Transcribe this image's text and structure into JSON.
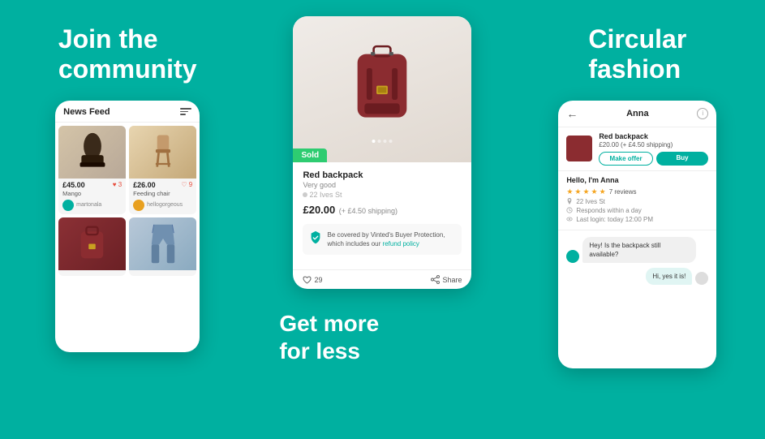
{
  "left": {
    "heading_line1": "Join the",
    "heading_line2": "community",
    "phone": {
      "header": "News Feed",
      "items": [
        {
          "price": "£45.00",
          "likes": "♥ 3",
          "name": "Mango",
          "user": "martonala",
          "type": "boot"
        },
        {
          "price": "£26.00",
          "likes": "♡ 9",
          "name": "Feeding chair",
          "user": "hellogorgeous",
          "type": "chair"
        },
        {
          "price": "",
          "likes": "",
          "name": "",
          "user": "",
          "type": "bag"
        },
        {
          "price": "",
          "likes": "",
          "name": "",
          "user": "",
          "type": "jeans"
        }
      ]
    }
  },
  "center": {
    "product": {
      "sold_badge": "Sold",
      "title": "Red backpack",
      "condition": "Very good",
      "location": "22 Ives St",
      "price": "£20.00",
      "shipping": "(+ £4.50 shipping)",
      "protection_text": "Be covered by Vinted's Buyer Protection, which includes our ",
      "protection_link": "refund policy",
      "likes": "29",
      "share": "Share"
    }
  },
  "bottom": {
    "heading_line1": "Get more",
    "heading_line2": "for less"
  },
  "right": {
    "heading_line1": "Circular",
    "heading_line2": "fashion",
    "phone": {
      "seller_name": "Anna",
      "product_name": "Red backpack",
      "product_price": "£20.00",
      "product_shipping": "(+ £4.50 shipping)",
      "btn_offer": "Make offer",
      "btn_buy": "Buy",
      "greeting": "Hello, I'm Anna",
      "stars": 5,
      "reviews": "7 reviews",
      "location": "22 Ives St",
      "response": "Responds within a day",
      "last_login": "Last login: today 12:00 PM",
      "msg1": "Hey! Is the backpack still available?",
      "msg2": "Hi, yes it is!"
    }
  }
}
